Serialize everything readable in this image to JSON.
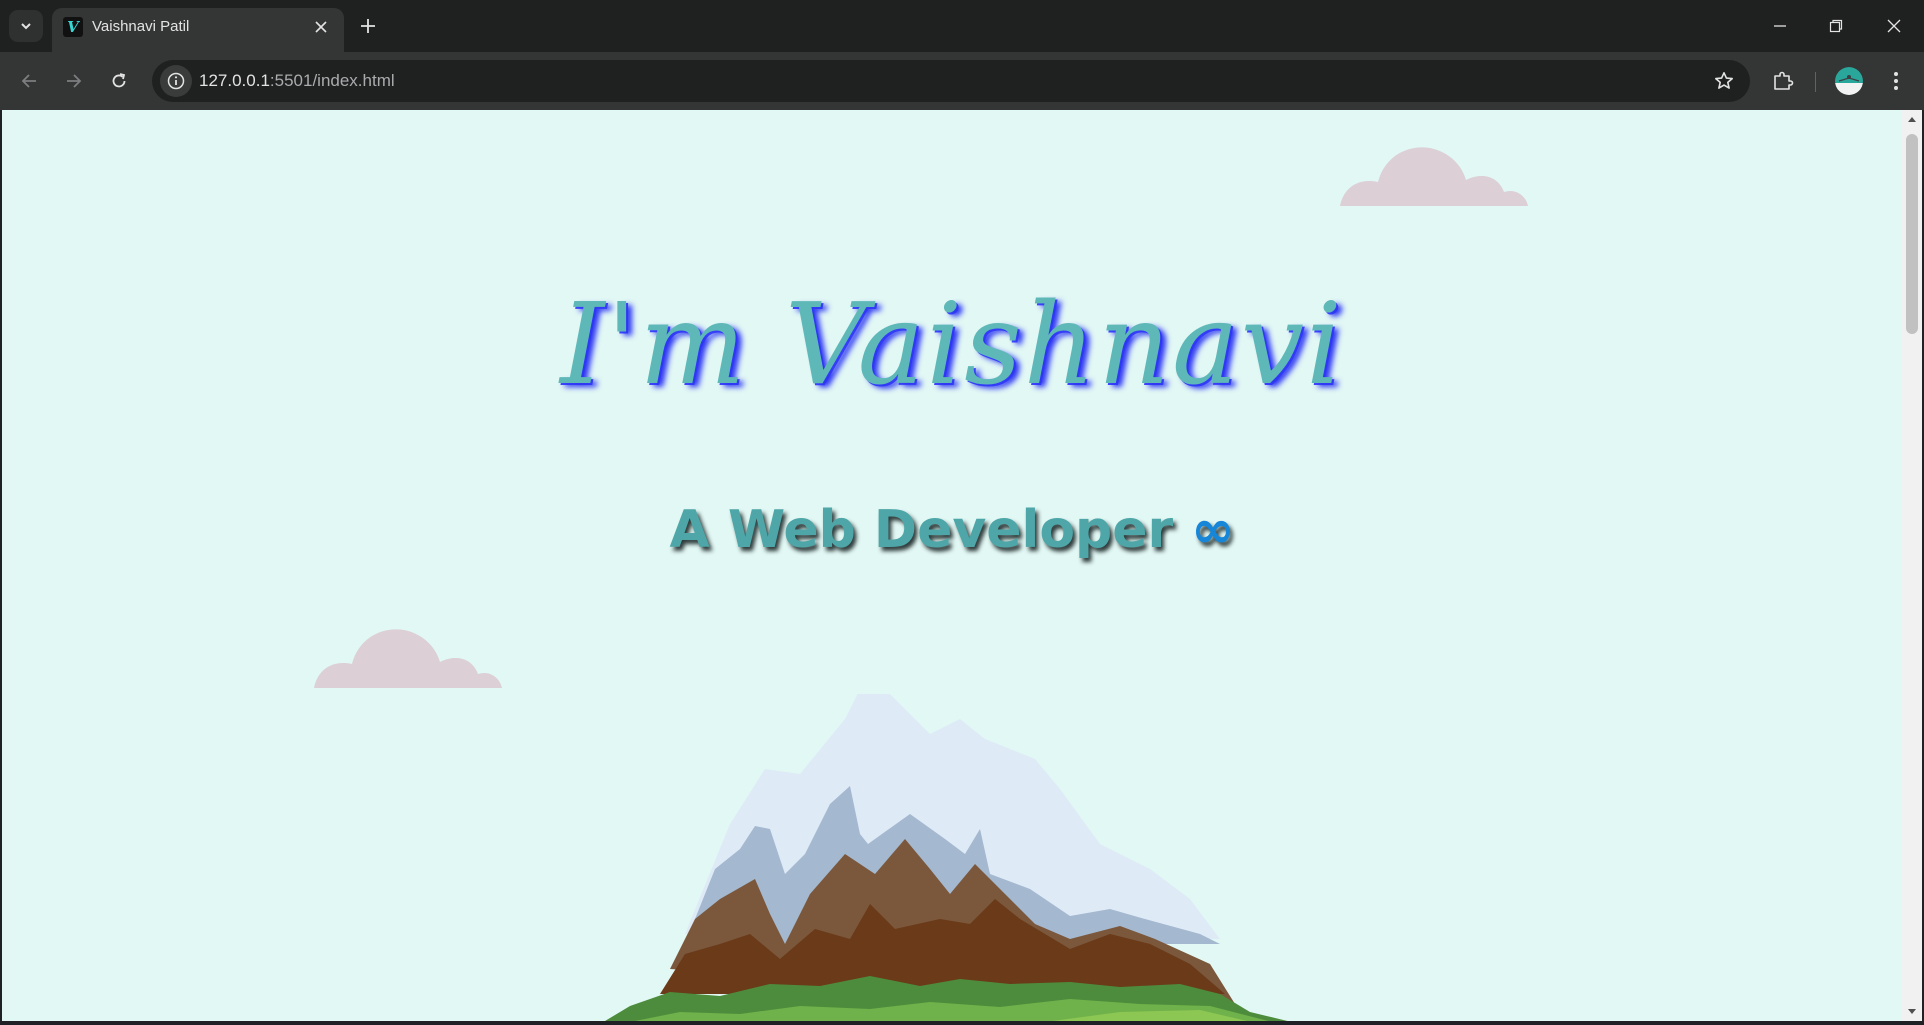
{
  "browser": {
    "tab_title": "Vaishnavi Patil",
    "favicon_letter": "V",
    "url_host": "127.0.0.1",
    "url_path": ":5501/index.html",
    "icons": {
      "tab_search": "chevron-down-icon",
      "tab_close": "close-icon",
      "new_tab": "plus-icon",
      "minimize": "minimize-icon",
      "restore": "restore-icon",
      "close_window": "close-icon",
      "back": "arrow-left-icon",
      "forward": "arrow-right-icon",
      "reload": "reload-icon",
      "site_info": "info-icon",
      "bookmark": "star-icon",
      "extensions": "puzzle-icon",
      "profile": "avatar-icon",
      "menu": "kebab-menu-icon"
    }
  },
  "page": {
    "headline": "I'm Vaishnavi",
    "subhead": "A Web Developer",
    "subhead_symbol": "∞",
    "colors": {
      "background": "#e2f8f4",
      "headline": "#5fb8b8",
      "headline_shadow": "#2e37f2",
      "subhead": "#4ea6a8",
      "infinity": "#1586d8",
      "cloud": "#dccfd5"
    }
  }
}
